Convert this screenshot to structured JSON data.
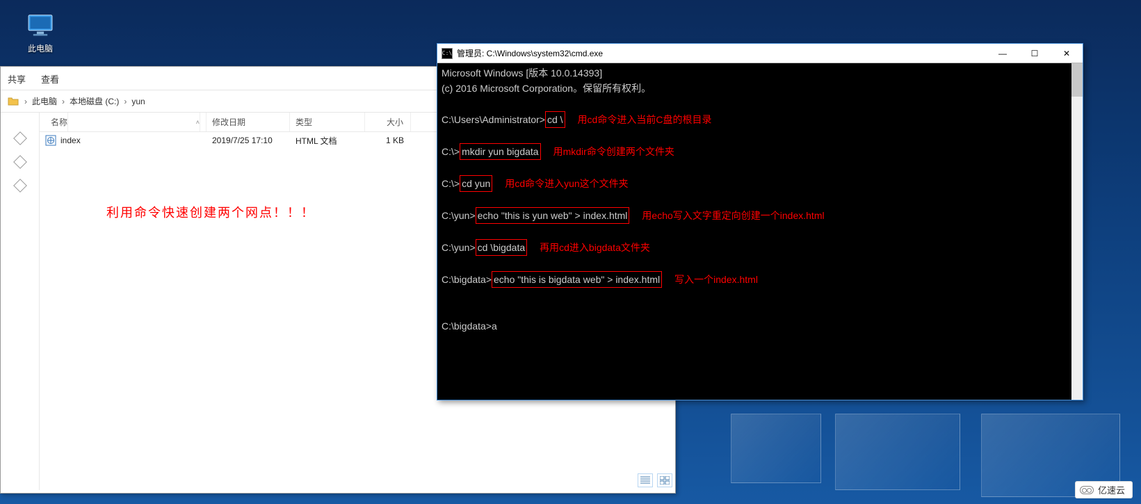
{
  "desktop": {
    "icon_label": "此电脑"
  },
  "explorer": {
    "tabs": {
      "share": "共享",
      "view": "查看"
    },
    "breadcrumb": {
      "pc": "此电脑",
      "drive": "本地磁盘 (C:)",
      "folder": "yun",
      "sep": "›"
    },
    "headers": {
      "name": "名称",
      "modified": "修改日期",
      "type": "类型",
      "size": "大小"
    },
    "files": [
      {
        "name": "index",
        "modified": "2019/7/25 17:10",
        "type": "HTML 文档",
        "size": "1 KB"
      }
    ],
    "note": "利用命令快速创建两个网点！！！"
  },
  "cmd": {
    "title": "管理员: C:\\Windows\\system32\\cmd.exe",
    "icon_text": "C:\\",
    "header1": "Microsoft Windows [版本 10.0.14393]",
    "header2": "(c) 2016 Microsoft Corporation。保留所有权利。",
    "lines": [
      {
        "prompt": "C:\\Users\\Administrator>",
        "boxed": "cd \\",
        "annot": "用cd命令进入当前C盘的根目录"
      },
      {
        "prompt": "C:\\>",
        "boxed": "mkdir yun bigdata",
        "annot": "用mkdir命令创建两个文件夹"
      },
      {
        "prompt": "C:\\>",
        "boxed": "cd yun",
        "annot": "用cd命令进入yun这个文件夹"
      },
      {
        "prompt": "C:\\yun>",
        "boxed": "echo \"this is yun web\" > index.html",
        "annot": "用echo写入文字重定向创建一个index.html"
      },
      {
        "prompt": "C:\\yun>",
        "boxed": "cd \\bigdata",
        "annot": "再用cd进入bigdata文件夹"
      },
      {
        "prompt": "C:\\bigdata>",
        "boxed": "echo \"this is bigdata web\" > index.html",
        "annot": "写入一个index.html"
      }
    ],
    "tail": "C:\\bigdata>a",
    "btn_min": "—",
    "btn_max": "☐",
    "btn_close": "✕"
  },
  "watermark": "亿速云"
}
